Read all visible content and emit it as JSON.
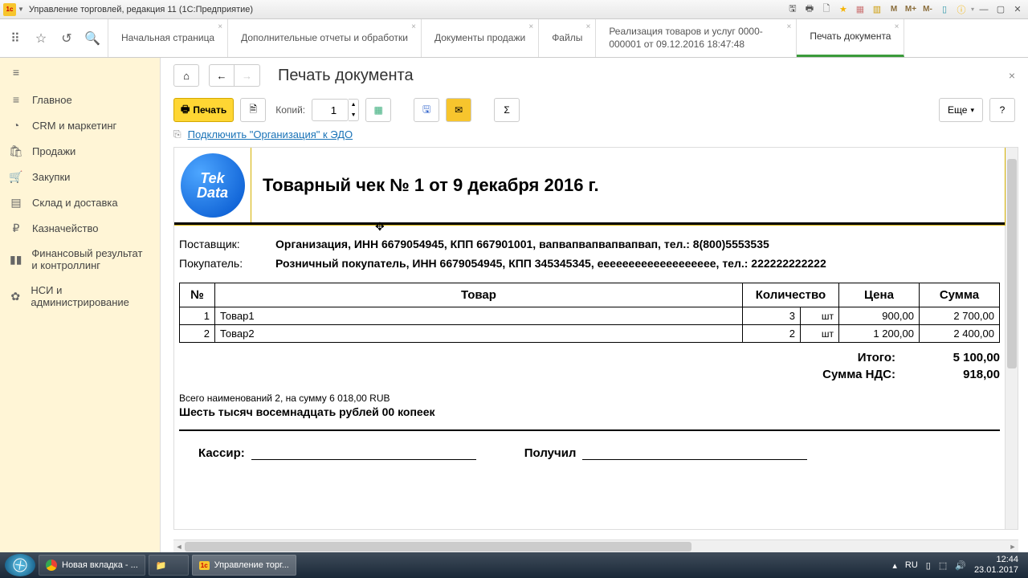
{
  "window": {
    "title": "Управление торговлей, редакция 11 (1С:Предприятие)"
  },
  "top_tabs": [
    {
      "label": "Начальная страница"
    },
    {
      "label": "Дополнительные отчеты и обработки"
    },
    {
      "label": "Документы продажи"
    },
    {
      "label": "Файлы"
    },
    {
      "label": "Реализация товаров и услуг 0000-000001 от 09.12.2016 18:47:48"
    },
    {
      "label": "Печать документа",
      "active": true
    }
  ],
  "sidebar": {
    "items": [
      {
        "icon": "≡",
        "label": "Главное"
      },
      {
        "icon": "◔",
        "label": "CRM и маркетинг"
      },
      {
        "icon": "🛍",
        "label": "Продажи"
      },
      {
        "icon": "🛒",
        "label": "Закупки"
      },
      {
        "icon": "▤",
        "label": "Склад и доставка"
      },
      {
        "icon": "₽",
        "label": "Казначейство"
      },
      {
        "icon": "▮▮",
        "label": "Финансовый результат и контроллинг"
      },
      {
        "icon": "✿",
        "label": "НСИ и администрирование"
      }
    ]
  },
  "page": {
    "title": "Печать документа"
  },
  "toolbar": {
    "print": "Печать",
    "copies_label": "Копий:",
    "copies_value": "1",
    "more": "Еще"
  },
  "edo": {
    "link": "Подключить \"Организация\" к ЭДО"
  },
  "doc": {
    "title": "Товарный чек № 1 от 9 декабря 2016 г.",
    "supplier_label": "Поставщик:",
    "supplier": "Организация, ИНН 6679054945, КПП 667901001, вапвапвапвапвапвап, тел.: 8(800)5553535",
    "buyer_label": "Покупатель:",
    "buyer": "Розничный покупатель, ИНН 6679054945, КПП 345345345, eeeeeeeeeeeeeeeeeee, тел.: 222222222222",
    "headers": {
      "num": "№",
      "item": "Товар",
      "qty": "Количество",
      "price": "Цена",
      "sum": "Сумма"
    },
    "rows": [
      {
        "n": "1",
        "name": "Товар1",
        "qty": "3",
        "unit": "шт",
        "price": "900,00",
        "sum": "2 700,00"
      },
      {
        "n": "2",
        "name": "Товар2",
        "qty": "2",
        "unit": "шт",
        "price": "1 200,00",
        "sum": "2 400,00"
      }
    ],
    "total_label": "Итого:",
    "total": "5 100,00",
    "vat_label": "Сумма НДС:",
    "vat": "918,00",
    "count_line": "Всего наименований 2, на сумму 6 018,00 RUB",
    "words": "Шесть тысяч восемнадцать рублей 00 копеек",
    "cashier": "Кассир:",
    "received": "Получил"
  },
  "taskbar": {
    "items": [
      {
        "label": "Новая вкладка - ...",
        "icon": "chrome"
      },
      {
        "label": "",
        "icon": "explorer"
      },
      {
        "label": "Управление торг...",
        "icon": "1c",
        "active": true
      }
    ],
    "lang": "RU",
    "time": "12:44",
    "date": "23.01.2017"
  }
}
